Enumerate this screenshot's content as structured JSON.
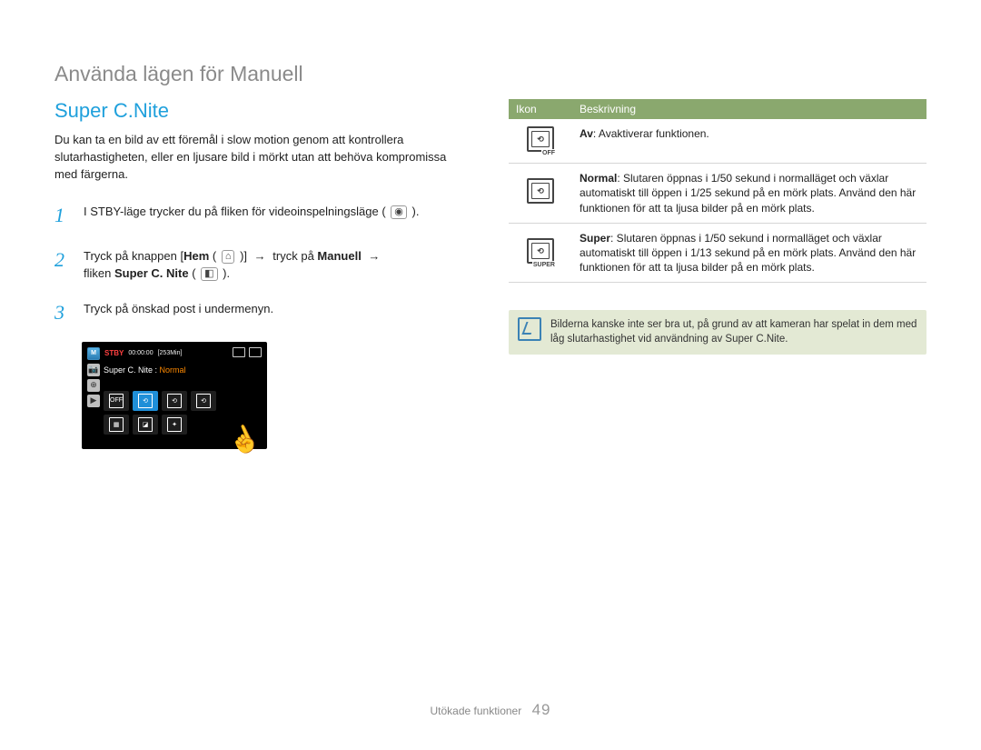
{
  "chapter_title": "Använda lägen för Manuell",
  "section_title": "Super C.Nite",
  "intro": "Du kan ta en bild av ett föremål i slow motion genom att kontrollera slutarhastigheten, eller en ljusare bild i mörkt utan att behöva kompromissa med färgerna.",
  "steps": {
    "s1": {
      "num": "1",
      "text_a": "I STBY-läge trycker du på fliken för videoinspelningsläge ( ",
      "glyph": "◉",
      "text_b": " )."
    },
    "s2": {
      "num": "2",
      "a": "Tryck på knappen [",
      "hem": "Hem",
      "hem_glyph_open": " ( ",
      "hem_glyph": "⌂",
      "hem_glyph_close": " )]",
      "arrow1": " → ",
      "mid": "tryck på ",
      "manuell": "Manuell",
      "arrow2": " → ",
      "tab_a": "fliken ",
      "tab_b": "Super C. Nite",
      "tab_glyph_open": " ( ",
      "tab_glyph": "◧",
      "tab_glyph_close": " )."
    },
    "s3": {
      "num": "3",
      "text": "Tryck på önskad post i undermenyn."
    }
  },
  "camera_screen": {
    "m": "M",
    "stby": "STBY",
    "time": "00:00:00",
    "min": "[253Min]",
    "title_a": "Super C. Nite : ",
    "title_b": "Normal",
    "side_cam": "📷",
    "side_zoom": "⊕",
    "side_play": "▶",
    "row1": {
      "off": "OFF",
      "n": "⟲",
      "s": "⟲",
      "x": "⟲"
    },
    "row2": {
      "a": "▦",
      "b": "◪",
      "c": "✦"
    }
  },
  "table": {
    "h_icon": "Ikon",
    "h_desc": "Beskrivning",
    "rows": [
      {
        "icon_inner": "⟲",
        "icon_sub": "OFF",
        "label": "Av",
        "desc": ": Avaktiverar funktionen."
      },
      {
        "icon_inner": "⟲",
        "icon_sub": "",
        "label": "Normal",
        "desc": ": Slutaren öppnas i 1/50 sekund i normalläget och växlar automatiskt till öppen i 1/25 sekund på en mörk plats. Använd den här funktionen för att ta ljusa bilder på en mörk plats."
      },
      {
        "icon_inner": "⟲",
        "icon_sub": "SUPER",
        "label": "Super",
        "desc": ": Slutaren öppnas i 1/50 sekund i normalläget och växlar automatiskt till öppen i 1/13 sekund på en mörk plats. Använd den här funktionen för att ta ljusa bilder på en mörk plats."
      }
    ]
  },
  "note_text": "Bilderna kanske inte ser bra ut, på grund av att kameran har spelat in dem med låg slutarhastighet vid användning av Super C.Nite.",
  "footer": {
    "section": "Utökade funktioner",
    "page": "49"
  }
}
